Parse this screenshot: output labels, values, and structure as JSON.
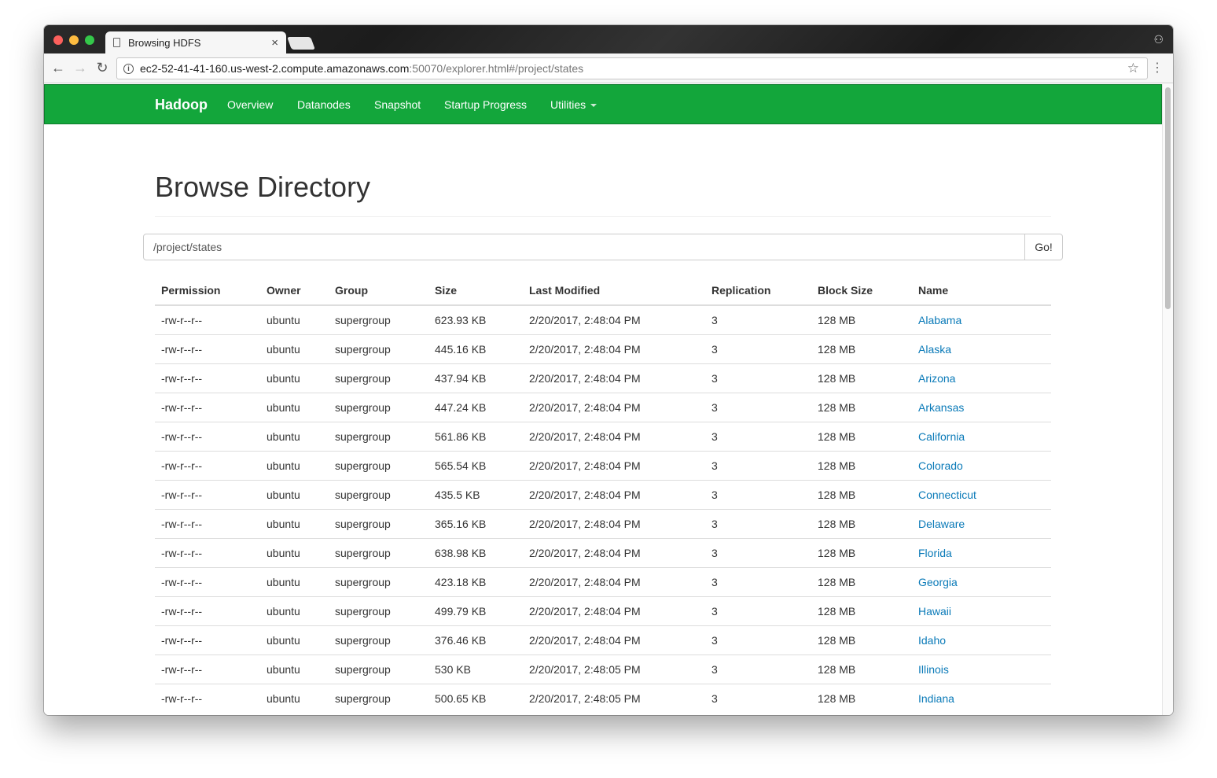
{
  "browser": {
    "tab_title": "Browsing HDFS",
    "close_glyph": "×",
    "url_host": "ec2-52-41-41-160.us-west-2.compute.amazonaws.com",
    "url_path": ":50070/explorer.html#/project/states",
    "back_glyph": "←",
    "forward_glyph": "→",
    "reload_glyph": "↻",
    "info_glyph": "i",
    "star_glyph": "☆",
    "menu_glyph": "⋮",
    "incognito_glyph": "⚇"
  },
  "navbar": {
    "brand": "Hadoop",
    "links": [
      "Overview",
      "Datanodes",
      "Snapshot",
      "Startup Progress",
      "Utilities"
    ],
    "color": "#13a63b"
  },
  "page": {
    "title": "Browse Directory",
    "path_value": "/project/states",
    "go_label": "Go!"
  },
  "table": {
    "headers": [
      "Permission",
      "Owner",
      "Group",
      "Size",
      "Last Modified",
      "Replication",
      "Block Size",
      "Name"
    ],
    "rows": [
      [
        "-rw-r--r--",
        "ubuntu",
        "supergroup",
        "623.93 KB",
        "2/20/2017, 2:48:04 PM",
        "3",
        "128 MB",
        "Alabama"
      ],
      [
        "-rw-r--r--",
        "ubuntu",
        "supergroup",
        "445.16 KB",
        "2/20/2017, 2:48:04 PM",
        "3",
        "128 MB",
        "Alaska"
      ],
      [
        "-rw-r--r--",
        "ubuntu",
        "supergroup",
        "437.94 KB",
        "2/20/2017, 2:48:04 PM",
        "3",
        "128 MB",
        "Arizona"
      ],
      [
        "-rw-r--r--",
        "ubuntu",
        "supergroup",
        "447.24 KB",
        "2/20/2017, 2:48:04 PM",
        "3",
        "128 MB",
        "Arkansas"
      ],
      [
        "-rw-r--r--",
        "ubuntu",
        "supergroup",
        "561.86 KB",
        "2/20/2017, 2:48:04 PM",
        "3",
        "128 MB",
        "California"
      ],
      [
        "-rw-r--r--",
        "ubuntu",
        "supergroup",
        "565.54 KB",
        "2/20/2017, 2:48:04 PM",
        "3",
        "128 MB",
        "Colorado"
      ],
      [
        "-rw-r--r--",
        "ubuntu",
        "supergroup",
        "435.5 KB",
        "2/20/2017, 2:48:04 PM",
        "3",
        "128 MB",
        "Connecticut"
      ],
      [
        "-rw-r--r--",
        "ubuntu",
        "supergroup",
        "365.16 KB",
        "2/20/2017, 2:48:04 PM",
        "3",
        "128 MB",
        "Delaware"
      ],
      [
        "-rw-r--r--",
        "ubuntu",
        "supergroup",
        "638.98 KB",
        "2/20/2017, 2:48:04 PM",
        "3",
        "128 MB",
        "Florida"
      ],
      [
        "-rw-r--r--",
        "ubuntu",
        "supergroup",
        "423.18 KB",
        "2/20/2017, 2:48:04 PM",
        "3",
        "128 MB",
        "Georgia"
      ],
      [
        "-rw-r--r--",
        "ubuntu",
        "supergroup",
        "499.79 KB",
        "2/20/2017, 2:48:04 PM",
        "3",
        "128 MB",
        "Hawaii"
      ],
      [
        "-rw-r--r--",
        "ubuntu",
        "supergroup",
        "376.46 KB",
        "2/20/2017, 2:48:04 PM",
        "3",
        "128 MB",
        "Idaho"
      ],
      [
        "-rw-r--r--",
        "ubuntu",
        "supergroup",
        "530 KB",
        "2/20/2017, 2:48:05 PM",
        "3",
        "128 MB",
        "Illinois"
      ],
      [
        "-rw-r--r--",
        "ubuntu",
        "supergroup",
        "500.65 KB",
        "2/20/2017, 2:48:05 PM",
        "3",
        "128 MB",
        "Indiana"
      ]
    ]
  }
}
